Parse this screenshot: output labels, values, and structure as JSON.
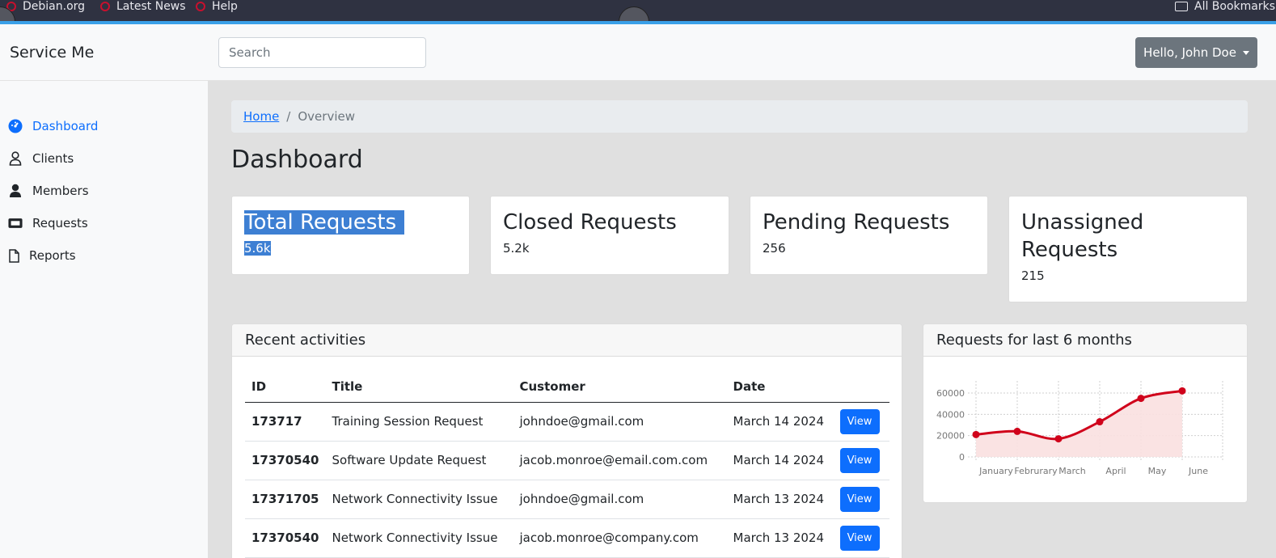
{
  "bookmarks": [
    {
      "label": "Debian.org"
    },
    {
      "label": "Latest News"
    },
    {
      "label": "Help"
    }
  ],
  "bookmarks_folder": "All Bookmarks",
  "navbar": {
    "brand": "Service Me",
    "search_placeholder": "Search",
    "user_menu": "Hello, John Doe"
  },
  "sidebar": {
    "items": [
      {
        "label": "Dashboard",
        "icon": "gauge-icon",
        "active": true
      },
      {
        "label": "Clients",
        "icon": "user-outline-icon"
      },
      {
        "label": "Members",
        "icon": "user-solid-icon"
      },
      {
        "label": "Requests",
        "icon": "ticket-icon"
      },
      {
        "label": "Reports",
        "icon": "file-icon"
      }
    ]
  },
  "breadcrumb": {
    "home": "Home",
    "separator": "/",
    "current": "Overview"
  },
  "page_title": "Dashboard",
  "stats": [
    {
      "title": "Total Requests",
      "value": "5.6k"
    },
    {
      "title": "Closed Requests",
      "value": "5.2k"
    },
    {
      "title": "Pending Requests",
      "value": "256"
    },
    {
      "title": "Unassigned Requests",
      "value": "215"
    }
  ],
  "recent": {
    "title": "Recent activities",
    "columns": [
      "ID",
      "Title",
      "Customer",
      "Date",
      ""
    ],
    "rows": [
      {
        "id": "173717",
        "title": "Training Session Request",
        "customer": "johndoe@gmail.com",
        "date": "March 14 2024",
        "action": "View"
      },
      {
        "id": "17370540",
        "title": "Software Update Request",
        "customer": "jacob.monroe@email.com.com",
        "date": "March 14 2024",
        "action": "View"
      },
      {
        "id": "17371705",
        "title": "Network Connectivity Issue",
        "customer": "johndoe@gmail.com",
        "date": "March 13 2024",
        "action": "View"
      },
      {
        "id": "17370540",
        "title": "Network Connectivity Issue",
        "customer": "jacob.monroe@company.com",
        "date": "March 13 2024",
        "action": "View"
      }
    ]
  },
  "chart_card": {
    "title": "Requests for last 6 months"
  },
  "chart_data": {
    "type": "area",
    "categories": [
      "January",
      "Februrary",
      "March",
      "April",
      "May",
      "June"
    ],
    "series": [
      {
        "values": [
          21000,
          24000,
          17000,
          33000,
          55000,
          62000
        ]
      }
    ],
    "ylim": [
      0,
      60000
    ],
    "yticks": [
      0,
      20000,
      40000,
      60000
    ],
    "grid": true,
    "colors": {
      "line": "#d0021b",
      "fill": "#f9e0e0",
      "grid": "#cfcfcf"
    }
  }
}
